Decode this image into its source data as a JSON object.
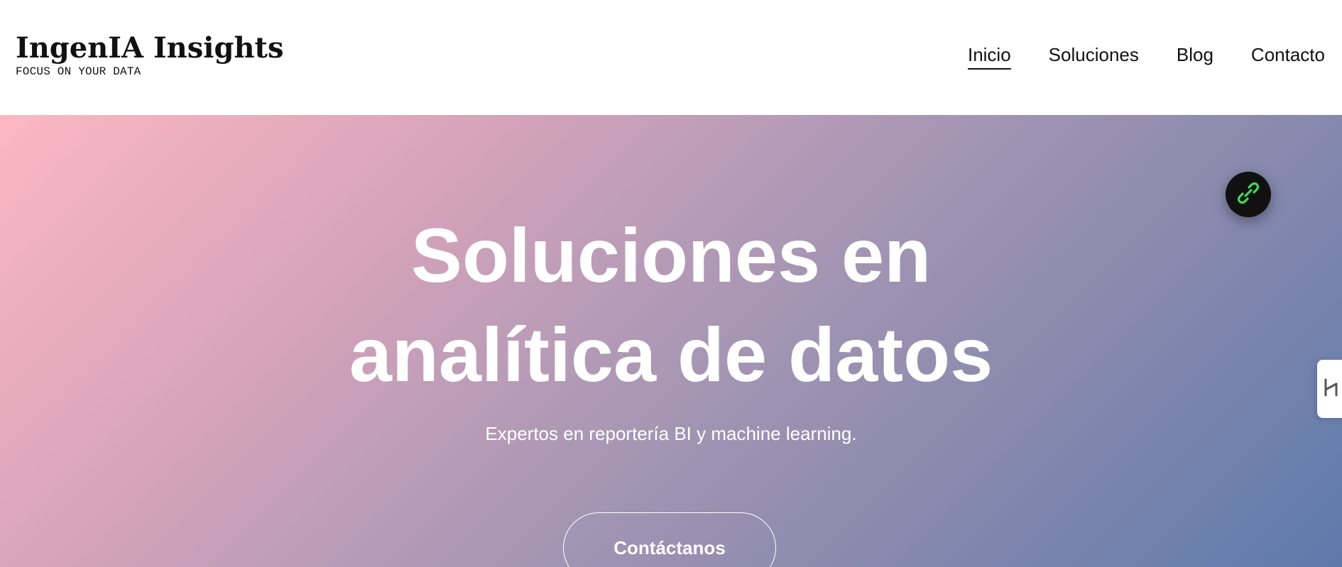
{
  "brand": {
    "title": "IngenIA Insights",
    "tagline": "FOCUS ON YOUR DATA"
  },
  "nav": {
    "items": [
      {
        "label": "Inicio",
        "active": true
      },
      {
        "label": "Soluciones",
        "active": false
      },
      {
        "label": "Blog",
        "active": false
      },
      {
        "label": "Contacto",
        "active": false
      }
    ]
  },
  "hero": {
    "title_line1": "Soluciones en",
    "title_line2": "analítica de datos",
    "subtitle": "Expertos en reportería BI y machine learning.",
    "cta_label": "Contáctanos"
  },
  "widgets": {
    "chat_icon": "link-chain-icon",
    "side_tab_icon": "hubspot-style-icon"
  },
  "colors": {
    "gradient_start": "#fcb7c2",
    "gradient_end": "#5d7aab",
    "chat_icon_accent": "#3ddc5a"
  }
}
